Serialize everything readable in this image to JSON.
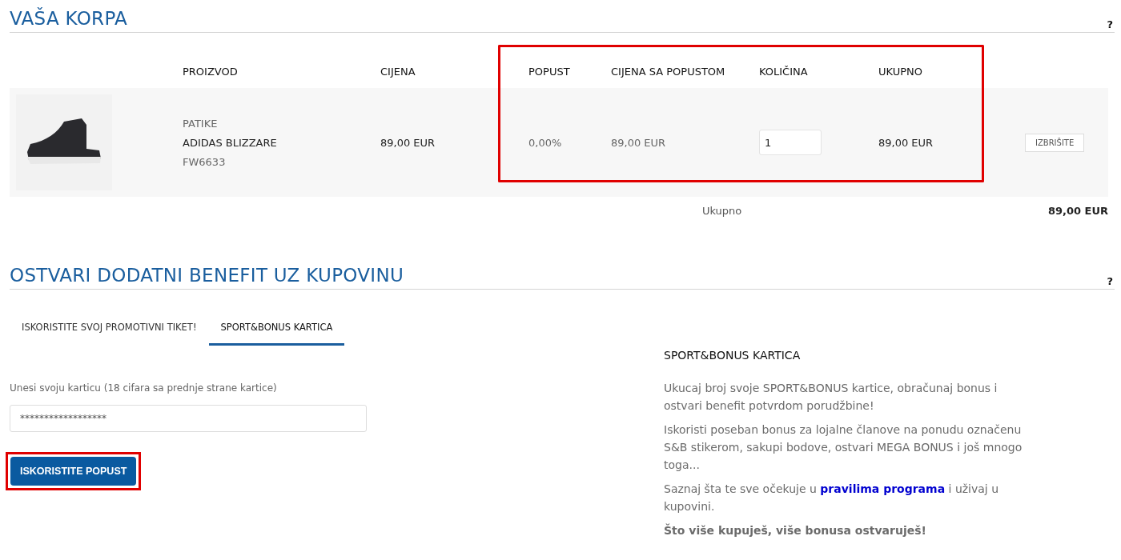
{
  "cart": {
    "title": "VAŠA KORPA",
    "help": "?",
    "columns": [
      {
        "label": "PROIZVOD",
        "highlighted": false
      },
      {
        "label": "CIJENA",
        "highlighted": false
      },
      {
        "label": "POPUST",
        "highlighted": true
      },
      {
        "label": "CIJENA SA POPUSTOM",
        "highlighted": true
      },
      {
        "label": "KOLIČINA",
        "highlighted": true
      },
      {
        "label": "UKUPNO",
        "highlighted": true
      }
    ],
    "rows": [
      {
        "category": "PATIKE",
        "name": "ADIDAS BLIZZARE",
        "code": "FW6633",
        "price": "89,00 EUR",
        "discount": "0,00%",
        "discounted_price": "89,00 EUR",
        "quantity": "1",
        "total": "89,00 EUR",
        "delete_button": "IZBRIŠITE"
      }
    ],
    "total": {
      "label": "Ukupno",
      "value": "89,00 EUR"
    }
  },
  "benefit": {
    "title": "OSTVARI DODATNI BENEFIT UZ KUPOVINU",
    "help": "?",
    "tabs": [
      {
        "label": "ISKORISTITE SVOJ PROMOTIVNI TIKET!",
        "selected": false
      },
      {
        "label": "SPORT&BONUS KARTICA",
        "selected": true
      }
    ],
    "card_field": {
      "label": "Unesi svoju karticu (18 cifara sa prednje strane kartice)",
      "value": "******************"
    },
    "apply_button": {
      "label": "ISKORISTITE POPUST",
      "highlighted": true
    },
    "info": {
      "title": "SPORT&BONUS KARTICA",
      "paragraphs": [
        {
          "kind": "text",
          "text": "Ukucaj broj svoje SPORT&BONUS kartice, obračunaj bonus i ostvari benefit potvrdom porudžbine!"
        },
        {
          "kind": "text",
          "text": "Iskoristi poseban bonus za lojalne članove na ponudu označenu S&B stikerom, sakupi bodove, ostvari MEGA BONUS i još mnogo toga..."
        },
        {
          "kind": "link",
          "before": "Saznaj šta te sve očekuje u",
          "link": "pravilima programa",
          "after": "i uživaj u kupovini."
        },
        {
          "kind": "bold",
          "text": "Što više kupuješ, više bonusa ostvaruješ!"
        }
      ]
    }
  }
}
